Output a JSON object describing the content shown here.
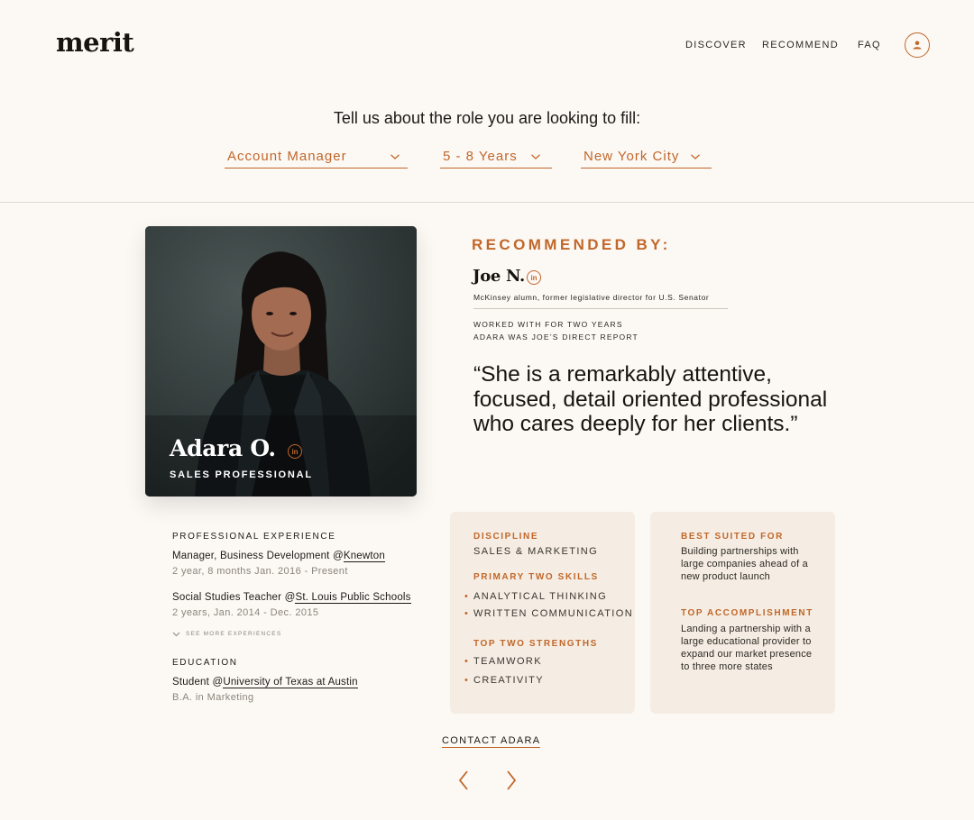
{
  "brand": {
    "logo": "merit"
  },
  "nav": {
    "items": [
      "DISCOVER",
      "RECOMMEND",
      "FAQ"
    ],
    "profile_icon": "user-icon"
  },
  "filters": {
    "prompt": "Tell us about the role you are looking to fill:",
    "role": "Account Manager",
    "experience": "5 - 8 Years",
    "location": "New York City",
    "chevron_icon": "chevron-down-icon"
  },
  "candidate": {
    "name": "Adara O.",
    "title": "SALES PROFESSIONAL",
    "linkedin": "in"
  },
  "recommendation": {
    "heading": "RECOMMENDED BY:",
    "recommender_name": "Joe N.",
    "recommender_linkedin": "in",
    "recommender_bio": "McKinsey alumn, former legislative director for U.S. Senator",
    "relationship_1": "WORKED WITH FOR TWO YEARS",
    "relationship_2": "ADARA WAS JOE’S DIRECT REPORT",
    "quote": "“She is a remarkably attentive, focused, detail oriented professional who cares deeply for her clients.”"
  },
  "experience": {
    "heading": "PROFESSIONAL EXPERIENCE",
    "jobs": [
      {
        "role": "Manager, Business Development @",
        "org": "Knewton",
        "meta": "2 year, 8 months Jan. 2016 - Present"
      },
      {
        "role": "Social Studies Teacher @",
        "org": "St. Louis Public Schools",
        "meta": "2 years, Jan. 2014 - Dec. 2015"
      }
    ],
    "see_more": "SEE MORE EXPERIENCES",
    "education_heading": "EDUCATION",
    "education": {
      "role": "Student @",
      "org": "University of Texas at Austin",
      "meta": "B.A. in Marketing"
    }
  },
  "skills_box": {
    "discipline_heading": "DISCIPLINE",
    "discipline": "SALES & MARKETING",
    "skills_heading": "PRIMARY TWO SKILLS",
    "skills": [
      "ANALYTICAL THINKING",
      "WRITTEN COMMUNICATION"
    ],
    "strengths_heading": "TOP TWO STRENGTHS",
    "strengths": [
      "TEAMWORK",
      "CREATIVITY"
    ]
  },
  "suited_box": {
    "suited_heading": "BEST SUITED FOR",
    "suited": "Building partnerships with large companies ahead of a new product launch",
    "accomplishment_heading": "TOP ACCOMPLISHMENT",
    "accomplishment": "Landing a partnership with a large educational provider to expand our market presence to three more states"
  },
  "actions": {
    "contact": "CONTACT ADARA",
    "prev_icon": "chevron-left-icon",
    "next_icon": "chevron-right-icon"
  },
  "colors": {
    "accent": "#c1672a",
    "background": "#fcf8f4",
    "card": "#f5ede3",
    "text": "#1c1a17"
  }
}
